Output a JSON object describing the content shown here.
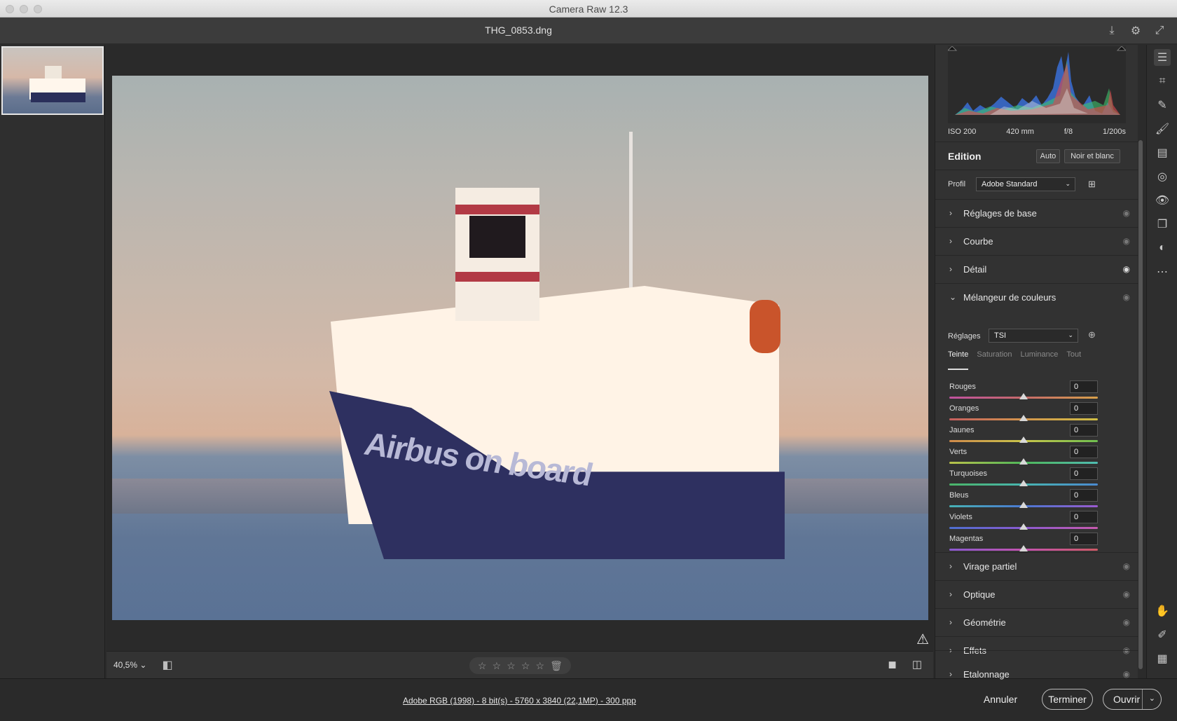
{
  "window": {
    "title": "Camera Raw 12.3"
  },
  "file": {
    "name": "THG_0853.dng"
  },
  "photo": {
    "hull_text": "Airbus on board"
  },
  "histogram": {
    "exif": [
      "ISO 200",
      "420 mm",
      "f/8",
      "1/200s"
    ]
  },
  "edition": {
    "title": "Edition",
    "auto_label": "Auto",
    "bw_label": "Noir et blanc",
    "profile_label": "Profil",
    "profile_value": "Adobe Standard"
  },
  "sections": {
    "basic": "Réglages de base",
    "curve": "Courbe",
    "detail": "Détail",
    "mixer": "Mélangeur de couleurs",
    "split": "Virage partiel",
    "optics": "Optique",
    "geometry": "Géométrie",
    "effects": "Effets",
    "calibration": "Etalonnage"
  },
  "mixer": {
    "adjust_label": "Réglages",
    "adjust_value": "TSI",
    "tabs": [
      "Teinte",
      "Saturation",
      "Luminance",
      "Tout"
    ],
    "sliders": [
      {
        "label": "Rouges",
        "value": "0",
        "track": "linear-gradient(90deg,#c0529f,#c66a6a,#d8a04a)"
      },
      {
        "label": "Oranges",
        "value": "0",
        "track": "linear-gradient(90deg,#c65f5f,#d3954c,#d1c045)"
      },
      {
        "label": "Jaunes",
        "value": "0",
        "track": "linear-gradient(90deg,#d08a4a,#c9c54a,#6fbf4f)"
      },
      {
        "label": "Verts",
        "value": "0",
        "track": "linear-gradient(90deg,#b9c24a,#4fb85a,#4fbcb2)"
      },
      {
        "label": "Turquoises",
        "value": "0",
        "track": "linear-gradient(90deg,#4bb568,#48b5b0,#4a8ad0)"
      },
      {
        "label": "Bleus",
        "value": "0",
        "track": "linear-gradient(90deg,#47b2b5,#4a78d2,#9a5ad0)"
      },
      {
        "label": "Violets",
        "value": "0",
        "track": "linear-gradient(90deg,#4d6fd0,#8a5ad0,#c75aae)"
      },
      {
        "label": "Magentas",
        "value": "0",
        "track": "linear-gradient(90deg,#8a5ad0,#c453b0,#cf5a66)"
      }
    ]
  },
  "viewbar": {
    "zoom": "40,5%"
  },
  "footer": {
    "info": "Adobe RGB (1998) - 8 bit(s) - 5760 x 3840 (22,1MP) - 300 ppp",
    "cancel": "Annuler",
    "done": "Terminer",
    "open": "Ouvrir"
  }
}
